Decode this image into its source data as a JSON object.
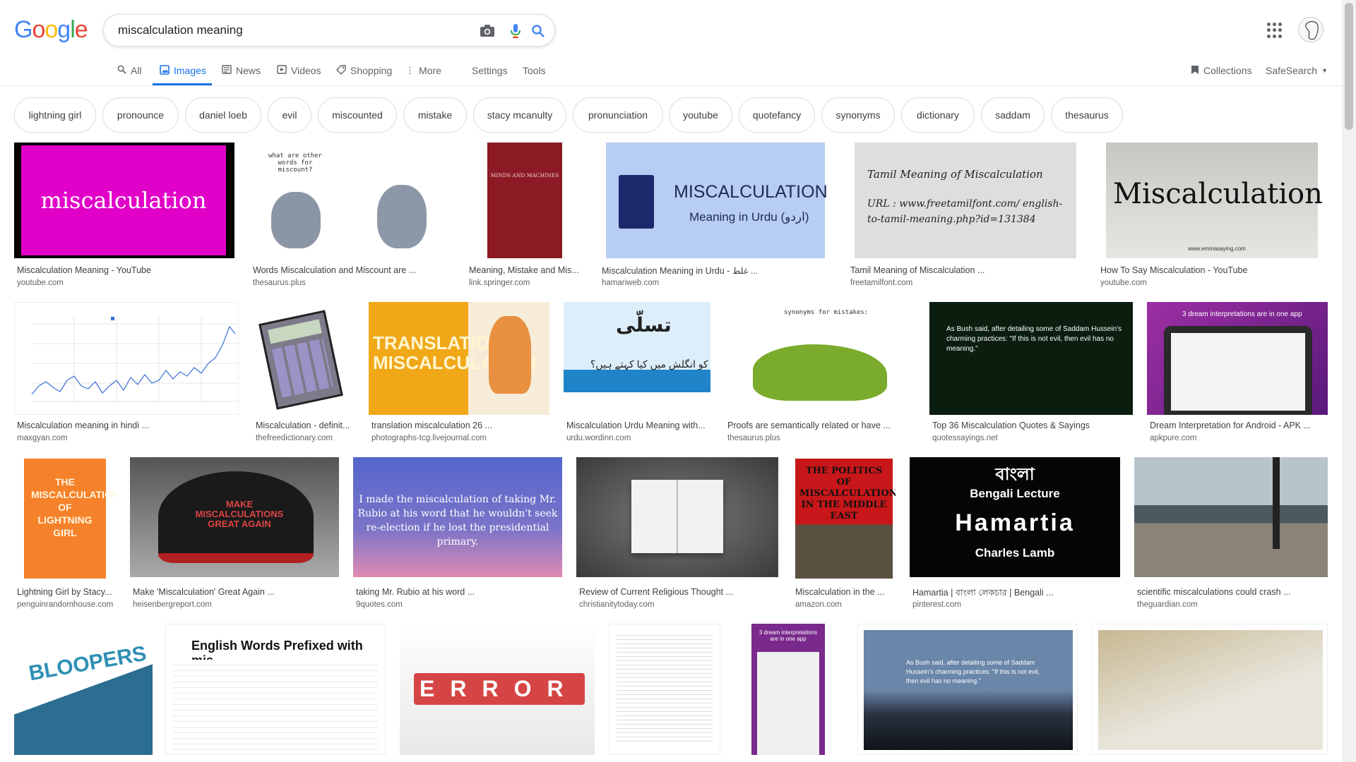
{
  "search": {
    "query": "miscalculation meaning"
  },
  "logo": {
    "letters": [
      "G",
      "o",
      "o",
      "g",
      "l",
      "e"
    ],
    "colors": [
      "#4285F4",
      "#EA4335",
      "#FBBC05",
      "#4285F4",
      "#34A853",
      "#EA4335"
    ]
  },
  "tabs": {
    "all": "All",
    "images": "Images",
    "news": "News",
    "videos": "Videos",
    "shopping": "Shopping",
    "more": "More",
    "settings": "Settings",
    "tools": "Tools",
    "collections": "Collections",
    "safesearch": "SafeSearch"
  },
  "chips": [
    "lightning girl",
    "pronounce",
    "daniel loeb",
    "evil",
    "miscounted",
    "mistake",
    "stacy mcanulty",
    "pronunciation",
    "youtube",
    "quotefancy",
    "synonyms",
    "dictionary",
    "saddam",
    "thesaurus"
  ],
  "results": [
    {
      "caption": "Miscalculation Meaning - YouTube",
      "domain": "youtube.com",
      "thumb_text": "miscalculation"
    },
    {
      "caption": "Words Miscalculation and Miscount are ...",
      "domain": "thesaurus.plus",
      "thumb_text": "what are other words for miscount?"
    },
    {
      "caption": "Meaning, Mistake and Mis...",
      "domain": "link.springer.com",
      "thumb_text": "MINDS AND MACHINES"
    },
    {
      "caption": "Miscalculation Meaning in Urdu - غلط ...",
      "domain": "hamariweb.com",
      "thumb_text": "MISCALCULATION",
      "thumb_sub": "Meaning in Urdu (اردو)"
    },
    {
      "caption": "Tamil Meaning of Miscalculation ...",
      "domain": "freetamilfont.com",
      "thumb_text": "Tamil Meaning of Miscalculation",
      "thumb_sub": "URL : www.freetamilfont.com/ english-to-tamil-meaning.php?id=131384"
    },
    {
      "caption": "How To Say Miscalculation - YouTube",
      "domain": "youtube.com",
      "thumb_text": "Miscalculation",
      "thumb_sub": "www.emmasaying.com"
    },
    {
      "caption": "Miscalculation meaning in hindi ...",
      "domain": "maxgyan.com",
      "thumb_text": ""
    },
    {
      "caption": "Miscalculation - definit...",
      "domain": "thefreedictionary.com",
      "thumb_text": ""
    },
    {
      "caption": "translation miscalculation 26 ...",
      "domain": "photographs-tcg.livejournal.com",
      "thumb_text": "TRANSLATION MISCALCULATION"
    },
    {
      "caption": "Miscalculation Urdu Meaning with...",
      "domain": "urdu.wordinn.com",
      "thumb_text": "تسلّی",
      "thumb_sub": "کو انگلش میں کیا کہتے ہیں؟"
    },
    {
      "caption": "Proofs are semantically related or have ...",
      "domain": "thesaurus.plus",
      "thumb_text": "synonyms for mistakes:"
    },
    {
      "caption": "Top 36 Miscalculation Quotes & Sayings",
      "domain": "quotessayings.net",
      "thumb_text": "As Bush said, after detailing some of Saddam Hussein's charming practices: \"If this is not evil, then evil has no meaning.\""
    },
    {
      "caption": "Dream Interpretation for Android - APK ...",
      "domain": "apkpure.com",
      "thumb_text": "3 dream interpretations are in one app"
    },
    {
      "caption": "Lightning Girl by Stacy...",
      "domain": "penguinrandomhouse.com",
      "thumb_text": "THE MISCALCULATIONS OF LIGHTNING GIRL"
    },
    {
      "caption": "Make 'Miscalculation' Great Again ...",
      "domain": "heisenbergreport.com",
      "thumb_text": "MAKE MISCALCULATIONS GREAT AGAIN"
    },
    {
      "caption": "taking Mr. Rubio at his word ...",
      "domain": "9quotes.com",
      "thumb_text": "I made the miscalculation of taking Mr. Rubio at his word that he wouldn't seek re-election if he lost the presidential primary."
    },
    {
      "caption": "Review of Current Religious Thought ...",
      "domain": "christianitytoday.com",
      "thumb_text": ""
    },
    {
      "caption": "Miscalculation in the ...",
      "domain": "amazon.com",
      "thumb_text": "THE POLITICS OF MISCALCULATION IN THE MIDDLE EAST"
    },
    {
      "caption": "Hamartia | বাংলা লেকচার | Bengali ...",
      "domain": "pinterest.com",
      "thumb_text": "Hamartia",
      "thumb_sub": "Bengali Lecture",
      "thumb_top": "বাংলা",
      "thumb_bottom": "Charles Lamb"
    },
    {
      "caption": "scientific miscalculations could crash ...",
      "domain": "theguardian.com",
      "thumb_text": ""
    },
    {
      "caption": "",
      "domain": "",
      "thumb_text": "BLOOPERS"
    },
    {
      "caption": "",
      "domain": "",
      "thumb_text": "English Words Prefixed with mis-"
    },
    {
      "caption": "",
      "domain": "",
      "thumb_text": "ERROR"
    },
    {
      "caption": "",
      "domain": "",
      "thumb_text": ""
    },
    {
      "caption": "",
      "domain": "",
      "thumb_text": "3 dream interpretations are in one app"
    },
    {
      "caption": "",
      "domain": "",
      "thumb_text": "As Bush said, after detailing some of Saddam Hussein's charming practices: \"If this is not evil, then evil has no meaning.\""
    },
    {
      "caption": "",
      "domain": "",
      "thumb_text": ""
    }
  ]
}
